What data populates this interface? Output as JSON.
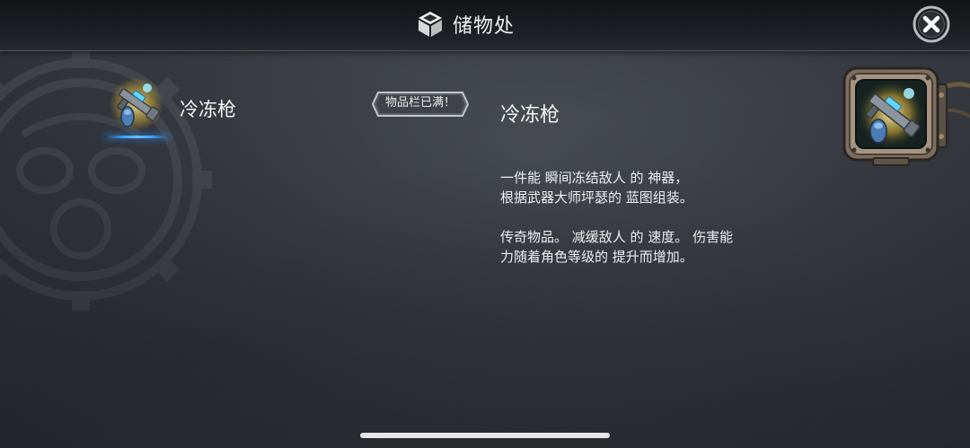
{
  "header": {
    "title": "储物处",
    "icon": "storage-box-icon"
  },
  "close_button": {
    "icon": "close-icon"
  },
  "inventory": {
    "items": [
      {
        "name": "冷冻枪",
        "icon": "freeze-gun-icon",
        "selected": true
      }
    ]
  },
  "badge": {
    "text": "物品栏已满！"
  },
  "detail": {
    "title": "冷冻枪",
    "description": [
      "一件能 瞬间冻结敌人 的 神器，\n根据武器大师坪瑟的 蓝图组装。",
      "传奇物品。 减缓敌人 的 速度。 伤害能\n力随着角色等级的 提升而增加。"
    ],
    "preview_icon": "freeze-gun-icon"
  },
  "colors": {
    "background": "#3a3e44",
    "header": "#1a1d21",
    "accent_glow": "#3ea6ff",
    "item_frame_gold": "#c9a53a"
  }
}
